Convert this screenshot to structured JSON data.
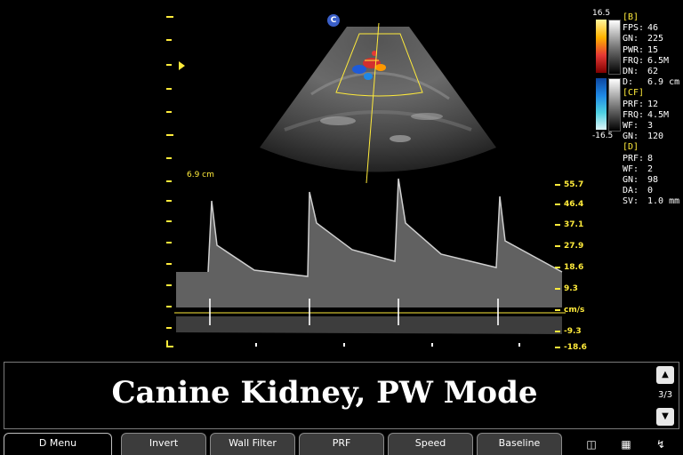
{
  "image_badge": "C",
  "depth": "6.9 cm",
  "colorbar": {
    "top": "16.5",
    "bottom": "-16.5"
  },
  "params": {
    "b_header": "[B]",
    "b": [
      {
        "k": "FPS:",
        "v": "46"
      },
      {
        "k": "GN:",
        "v": "225"
      },
      {
        "k": "PWR:",
        "v": "15"
      },
      {
        "k": "FRQ:",
        "v": "6.5M"
      },
      {
        "k": "DN:",
        "v": "62"
      },
      {
        "k": "D:",
        "v": "6.9 cm"
      }
    ],
    "cf_header": "[CF]",
    "cf": [
      {
        "k": "PRF:",
        "v": "12"
      },
      {
        "k": "FRQ:",
        "v": "4.5M"
      },
      {
        "k": "WF:",
        "v": "3"
      },
      {
        "k": "GN:",
        "v": "120"
      }
    ],
    "d_header": "[D]",
    "d": [
      {
        "k": "PRF:",
        "v": "8"
      },
      {
        "k": "WF:",
        "v": "2"
      },
      {
        "k": "GN:",
        "v": "98"
      },
      {
        "k": "DA:",
        "v": "0"
      },
      {
        "k": "SV:",
        "v": "1.0 mm"
      }
    ]
  },
  "velocity_scale": {
    "labels": [
      "55.7",
      "46.4",
      "37.1",
      "27.9",
      "18.6",
      "9.3",
      "cm/s",
      "-9.3",
      "-18.6"
    ]
  },
  "annotation": "Canine Kidney, PW Mode",
  "page_indicator": "3/3",
  "nav": {
    "up": "▲",
    "down": "▼"
  },
  "softkeys": [
    {
      "label": "D Menu",
      "active": true
    },
    {
      "label": "Invert",
      "active": false
    },
    {
      "label": "Wall Filter",
      "active": false
    },
    {
      "label": "PRF",
      "active": false
    },
    {
      "label": "Speed",
      "active": false
    },
    {
      "label": "Baseline",
      "active": false
    }
  ],
  "colors": {
    "accent": "#ffeb3b",
    "panel_bg": "#3c3c3c"
  }
}
